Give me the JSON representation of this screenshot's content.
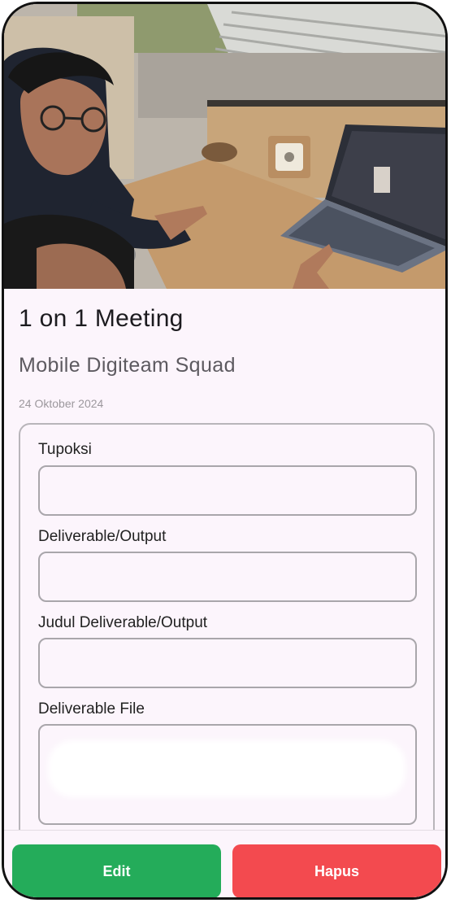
{
  "meeting": {
    "title": "1 on 1 Meeting",
    "team": "Mobile Digiteam Squad",
    "date": "24 Oktober 2024"
  },
  "form": {
    "fields": [
      {
        "label": "Tupoksi",
        "value": ""
      },
      {
        "label": "Deliverable/Output",
        "value": ""
      },
      {
        "label": "Judul Deliverable/Output",
        "value": ""
      },
      {
        "label": "Deliverable File",
        "value": ""
      }
    ]
  },
  "actions": {
    "edit_label": "Edit",
    "delete_label": "Hapus"
  },
  "colors": {
    "background": "#fcf5fc",
    "edit_button": "#24ac5a",
    "delete_button": "#f34a4f"
  }
}
